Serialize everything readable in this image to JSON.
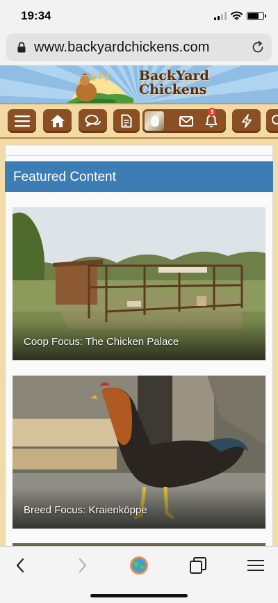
{
  "status_bar": {
    "time": "19:34",
    "signal_bars": 2,
    "signal_bars_total": 4,
    "battery_level": 0.7
  },
  "browser": {
    "url": "www.backyardchickens.com",
    "icons": {
      "lock": "lock-icon",
      "reload": "reload-icon"
    }
  },
  "site": {
    "logo_line1": "BackYard",
    "logo_line2": "Chickens",
    "colors": {
      "nav_bg": "#f3d9a4",
      "nav_button": "#8a4f22",
      "featured_header": "#3b7db4",
      "badge": "#e03a2f"
    }
  },
  "nav": {
    "items": [
      {
        "name": "menu-icon"
      },
      {
        "name": "home-icon"
      },
      {
        "name": "chat-icon"
      },
      {
        "name": "document-icon"
      },
      {
        "name": "avatar"
      },
      {
        "name": "mail-icon"
      },
      {
        "name": "bell-icon",
        "badge": "3"
      },
      {
        "name": "lightning-icon"
      },
      {
        "name": "search-icon"
      }
    ],
    "alerts_badge": "3"
  },
  "featured": {
    "title": "Featured Content",
    "cards": [
      {
        "caption": "Coop Focus: The Chicken Palace"
      },
      {
        "caption": "Breed Focus: Kraienköppe"
      }
    ]
  },
  "toolbar": {
    "icons": [
      "back-icon",
      "forward-icon",
      "browser-icon",
      "tabs-icon",
      "menu-icon"
    ]
  }
}
